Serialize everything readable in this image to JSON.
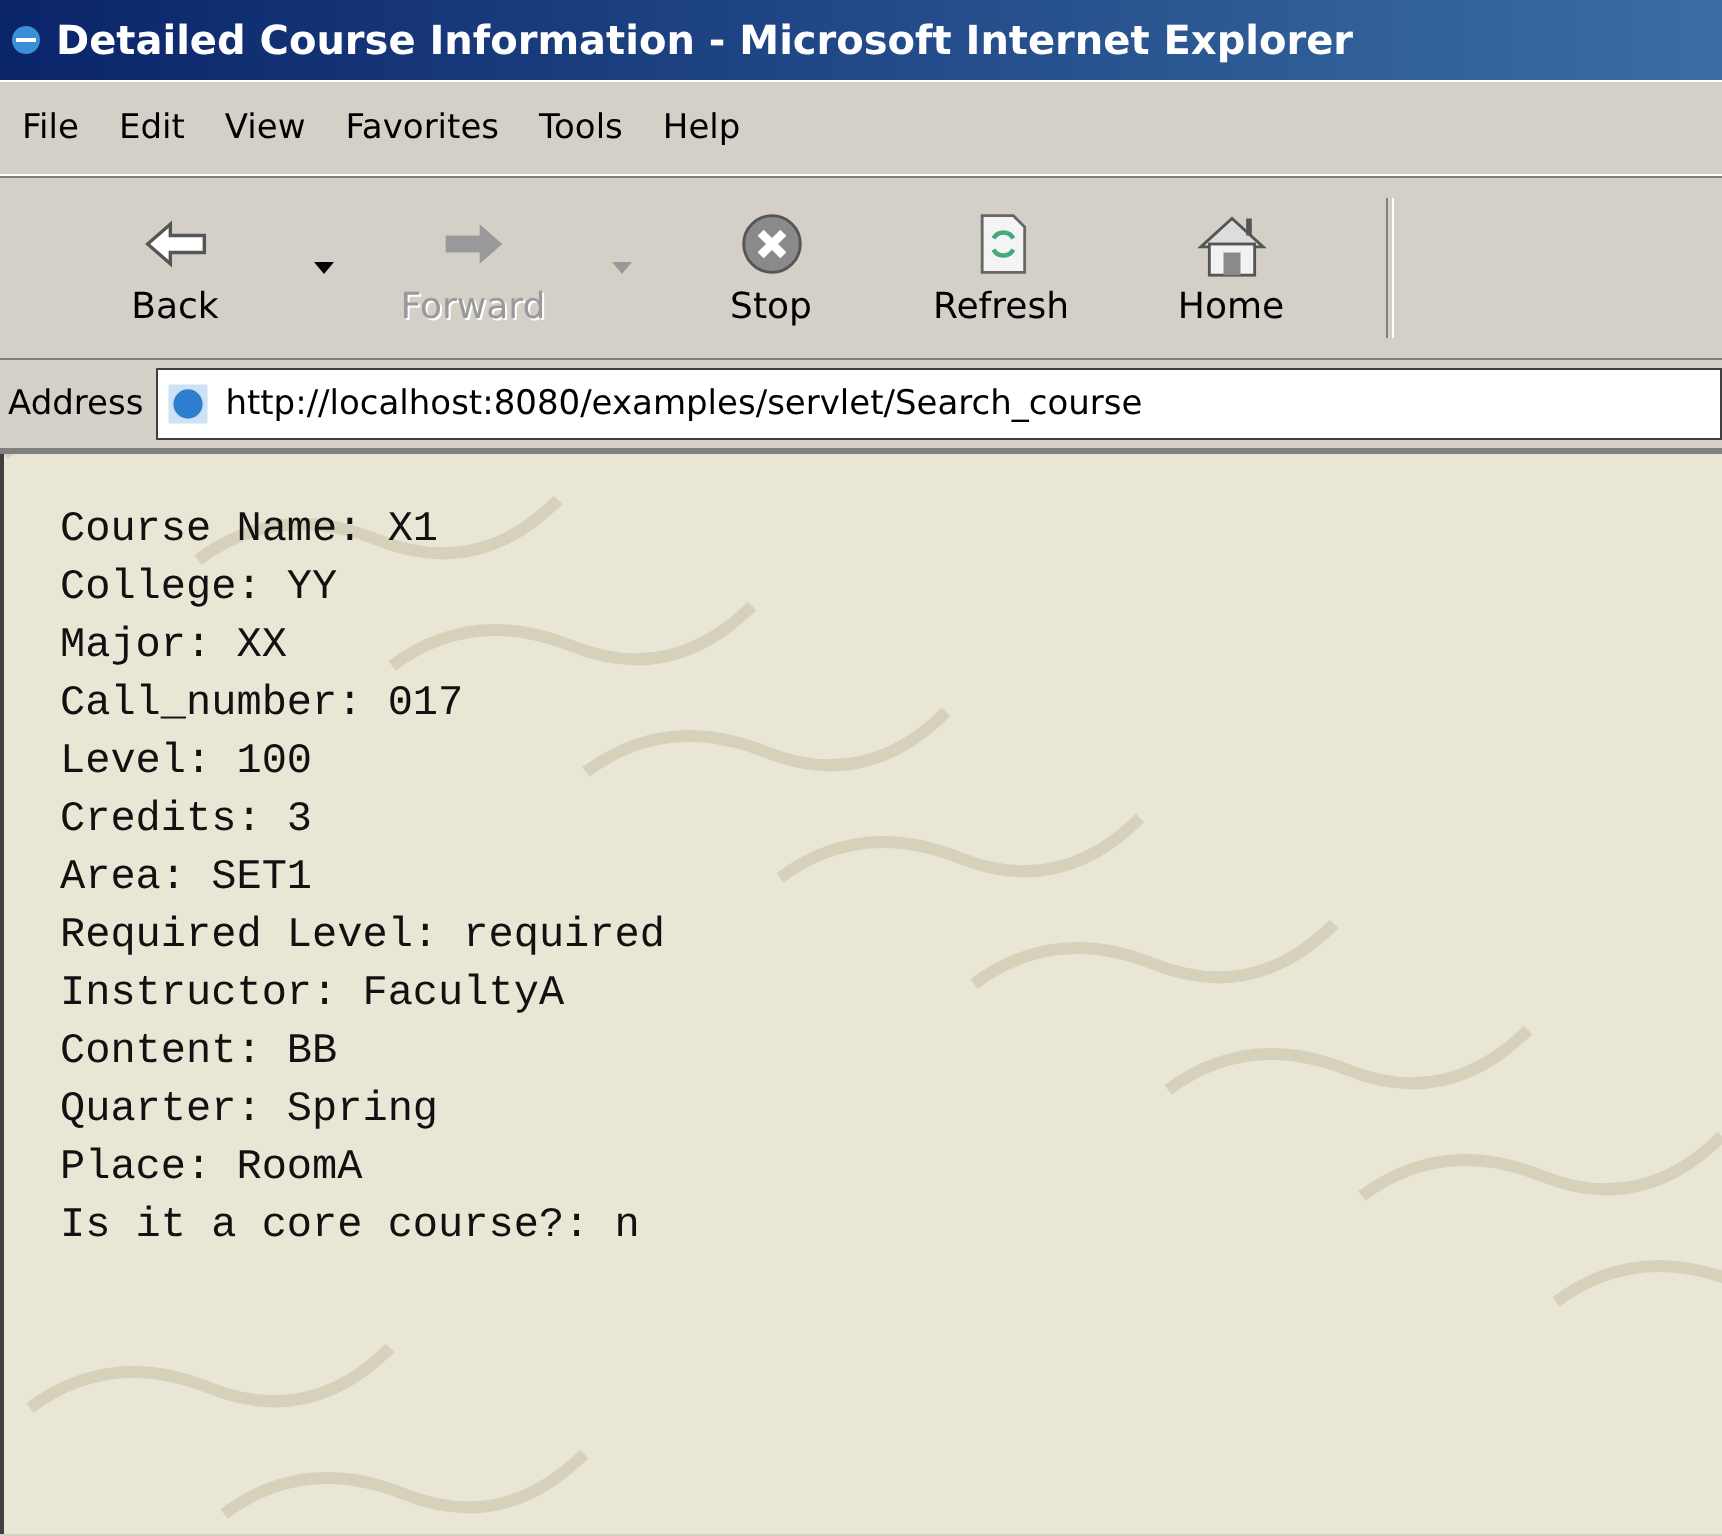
{
  "window": {
    "title": "Detailed Course Information - Microsoft Internet Explorer"
  },
  "menu": [
    "File",
    "Edit",
    "View",
    "Favorites",
    "Tools",
    "Help"
  ],
  "toolbar": [
    {
      "kind": "back",
      "label": "Back",
      "disabled": false,
      "dropdown": true
    },
    {
      "kind": "forward",
      "label": "Forward",
      "disabled": true,
      "dropdown": true
    },
    {
      "kind": "stop",
      "label": "Stop",
      "disabled": false,
      "dropdown": false
    },
    {
      "kind": "refresh",
      "label": "Refresh",
      "disabled": false,
      "dropdown": false
    },
    {
      "kind": "home",
      "label": "Home",
      "disabled": false,
      "dropdown": false
    }
  ],
  "address": {
    "label": "Address",
    "value": "http://localhost:8080/examples/servlet/Search_course"
  },
  "content": {
    "lines": [
      "Course Name: X1",
      "College: YY",
      "Major: XX",
      "Call_number: 017",
      "Level: 100",
      "Credits: 3",
      "Area: SET1",
      "Required Level: required",
      "Instructor: FacultyA",
      "Content: BB",
      "Quarter: Spring",
      "Place: RoomA",
      "Is it a core course?: n"
    ]
  }
}
